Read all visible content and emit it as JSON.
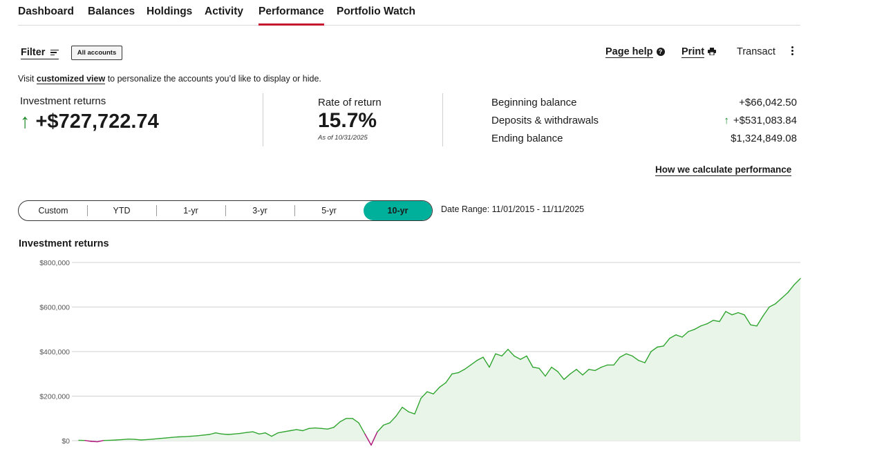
{
  "nav": {
    "tabs": [
      "Dashboard",
      "Balances",
      "Holdings",
      "Activity",
      "Performance",
      "Portfolio Watch"
    ],
    "active": "Performance"
  },
  "toolbar": {
    "filter_label": "Filter",
    "accounts_chip": "All accounts",
    "page_help": "Page help",
    "print": "Print",
    "transact": "Transact"
  },
  "notice": {
    "prefix": "Visit ",
    "link": "customized view",
    "suffix": " to personalize the accounts you’d like to display or hide."
  },
  "summary": {
    "investment_returns_label": "Investment returns",
    "investment_returns_value": "+$727,722.74",
    "rate_label": "Rate of return",
    "rate_value": "15.7%",
    "rate_asof": "As of 10/31/2025",
    "beginning_label": "Beginning balance",
    "beginning_value": "+$66,042.50",
    "deposits_label": "Deposits & withdrawals",
    "deposits_value": "+$531,083.84",
    "ending_label": "Ending balance",
    "ending_value": "$1,324,849.08",
    "how_link": "How we calculate performance"
  },
  "range": {
    "options": [
      "Custom",
      "YTD",
      "1-yr",
      "3-yr",
      "5-yr",
      "10-yr"
    ],
    "selected": "10-yr",
    "date_range": "Date Range: 11/01/2015 - 11/11/2025"
  },
  "colors": {
    "accent_red": "#c4122f",
    "selected_teal": "#00b09b",
    "positive_green": "#1d8a2a",
    "negative_magenta": "#b0127a",
    "area_fill": "#e9f5e9"
  },
  "chart_data": {
    "type": "area",
    "title": "Investment returns",
    "ylim": [
      0,
      800000
    ],
    "y_ticks": [
      "$800,000",
      "$600,000",
      "$400,000",
      "$200,000",
      "$0"
    ],
    "grid": true,
    "x_range_dates": [
      "11/01/2015",
      "11/11/2025"
    ],
    "y": [
      2000,
      1000,
      -3000,
      -5000,
      1000,
      2000,
      3000,
      5000,
      7000,
      6000,
      3000,
      5000,
      7000,
      10000,
      12000,
      15000,
      17000,
      18000,
      20000,
      22000,
      25000,
      28000,
      35000,
      30000,
      28000,
      30000,
      33000,
      37000,
      40000,
      30000,
      35000,
      20000,
      35000,
      40000,
      45000,
      50000,
      45000,
      55000,
      57000,
      55000,
      52000,
      60000,
      85000,
      100000,
      100000,
      80000,
      30000,
      -20000,
      40000,
      70000,
      80000,
      110000,
      150000,
      130000,
      120000,
      190000,
      220000,
      210000,
      240000,
      260000,
      300000,
      305000,
      320000,
      340000,
      360000,
      375000,
      330000,
      390000,
      380000,
      410000,
      380000,
      365000,
      380000,
      330000,
      325000,
      290000,
      330000,
      310000,
      275000,
      300000,
      320000,
      295000,
      320000,
      315000,
      330000,
      340000,
      340000,
      375000,
      390000,
      380000,
      360000,
      350000,
      400000,
      420000,
      425000,
      460000,
      475000,
      465000,
      490000,
      500000,
      515000,
      525000,
      540000,
      535000,
      580000,
      565000,
      575000,
      565000,
      520000,
      515000,
      560000,
      600000,
      615000,
      640000,
      665000,
      700000,
      728000
    ]
  }
}
